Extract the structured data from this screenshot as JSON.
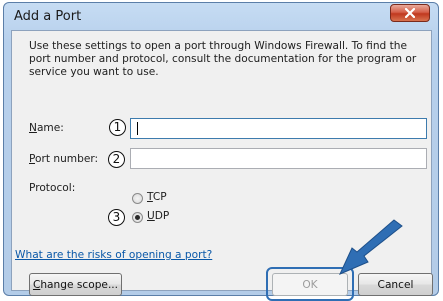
{
  "window": {
    "title": "Add a Port",
    "close_icon": "close-icon"
  },
  "description": "Use these settings to open a port through Windows Firewall. To find the port number and protocol, consult the documentation for the program or service you want to use.",
  "form": {
    "name_label": {
      "mnemonic": "N",
      "rest": "ame:"
    },
    "name_value": "",
    "port_label": {
      "mnemonic": "P",
      "rest": "ort number:"
    },
    "port_value": "",
    "protocol_label": "Protocol:",
    "tcp": {
      "mnemonic": "T",
      "rest": "CP",
      "selected": false
    },
    "udp": {
      "mnemonic": "U",
      "rest": "DP",
      "selected": true
    }
  },
  "callouts": [
    "1",
    "2",
    "3"
  ],
  "link_text": "What are the risks of opening a port?",
  "buttons": {
    "change_scope": {
      "mnemonic": "C",
      "rest": "hange scope..."
    },
    "ok": "OK",
    "cancel": "Cancel"
  },
  "colors": {
    "highlight": "#2f6eb4",
    "arrow": "#2f6eb4",
    "link": "#0a58a8"
  }
}
